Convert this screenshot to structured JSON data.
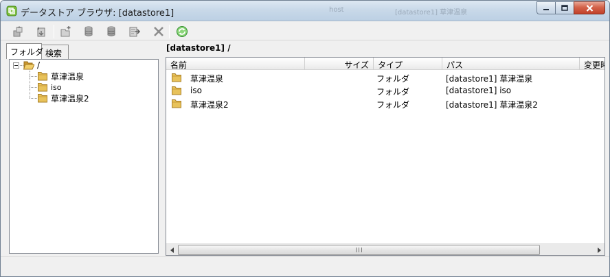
{
  "window": {
    "title": "データストア ブラウザ: [datastore1]",
    "ghost_texts": [
      "host",
      "[datastore1] 草津温泉"
    ]
  },
  "toolbar": {
    "buttons": [
      {
        "icon": "upload-icon"
      },
      {
        "icon": "download-icon"
      },
      {
        "icon": "new-folder-icon"
      },
      {
        "icon": "datastore-icon"
      },
      {
        "icon": "datastore-remove-icon"
      },
      {
        "icon": "move-icon"
      },
      {
        "icon": "delete-icon"
      },
      {
        "icon": "refresh-icon"
      }
    ]
  },
  "left": {
    "tabs": [
      "フォルダ",
      "検索"
    ],
    "tree": {
      "root": "/",
      "children": [
        "草津温泉",
        "iso",
        "草津温泉2"
      ]
    }
  },
  "right": {
    "path": "[datastore1] /",
    "columns": [
      "名前",
      "サイズ",
      "タイプ",
      "パス",
      "変更時"
    ],
    "rows": [
      {
        "name": "草津温泉",
        "size": "",
        "type": "フォルダ",
        "path": "[datastore1] 草津温泉"
      },
      {
        "name": "iso",
        "size": "",
        "type": "フォルダ",
        "path": "[datastore1] iso"
      },
      {
        "name": "草津温泉2",
        "size": "",
        "type": "フォルダ",
        "path": "[datastore1] 草津温泉2"
      }
    ]
  },
  "colors": {
    "folder": "#e8c25a",
    "folder_dark": "#b8892a",
    "refresh": "#3fa33a"
  }
}
